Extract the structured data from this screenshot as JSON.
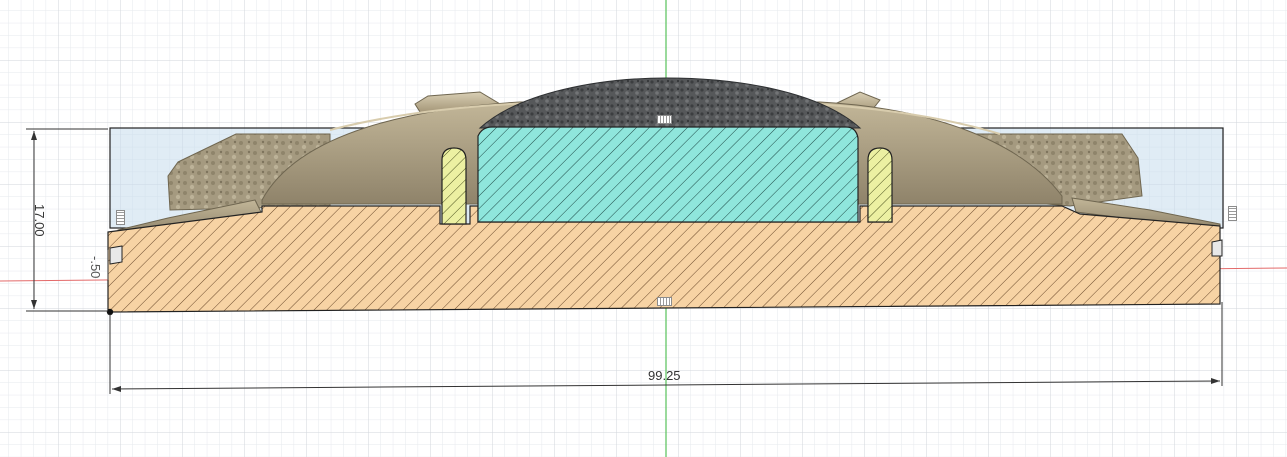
{
  "viewport": {
    "grid": true
  },
  "dimensions": {
    "height_label": "17.00",
    "offset_label": "-.50",
    "width_label": "99.25"
  },
  "colors": {
    "background": "#ffffff",
    "grid_minor": "#e6e9ed",
    "grid_major": "#d2d6db",
    "x_axis": "#e36a6a",
    "y_axis": "#58c25a",
    "sketch_profile": "#c7dcec",
    "base_section": "#f7d3a4",
    "magnet_section": "#8fe6dc",
    "ring_section": "#ecf0a2",
    "model_body": "#a59a80",
    "model_dome": "#56585a"
  }
}
